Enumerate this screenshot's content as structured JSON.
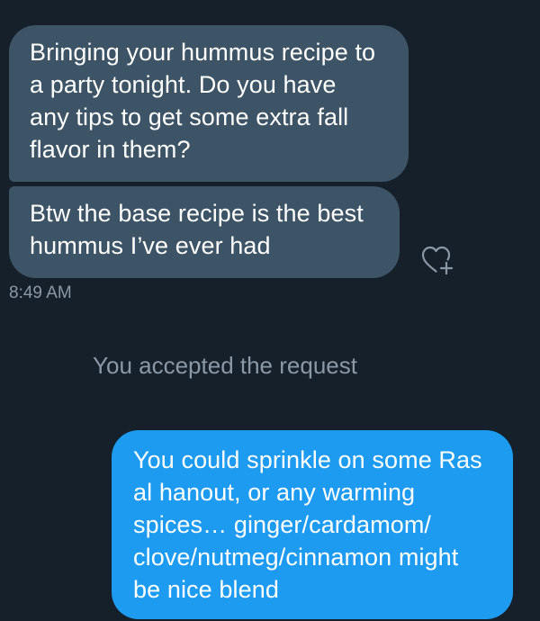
{
  "conversation": {
    "received_messages": [
      {
        "lines": [
          "Bringing your hummus recipe to",
          "a party tonight. Do you have",
          "any tips to get some extra fall",
          "flavor in them?"
        ]
      },
      {
        "lines": [
          "Btw the base recipe is the best",
          "hummus I’ve ever had"
        ]
      }
    ],
    "react_icon": "heart-plus-icon",
    "timestamp": "8:49 AM",
    "system_message": "You accepted the request",
    "sent_messages": [
      {
        "lines": [
          "You could sprinkle on some Ras",
          "al hanout, or any warming",
          "spices… ginger/cardamom/",
          "clove/nutmeg/cinnamon might",
          "be nice blend"
        ]
      }
    ]
  },
  "colors": {
    "background": "#15202b",
    "received_bubble": "#3d5466",
    "sent_bubble": "#1d9bf0",
    "muted_text": "#8b98a5"
  }
}
